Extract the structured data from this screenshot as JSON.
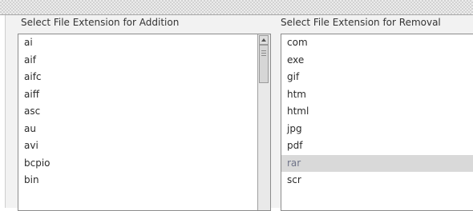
{
  "addition": {
    "label": "Select File Extension for Addition",
    "items": [
      "ai",
      "aif",
      "aifc",
      "aiff",
      "asc",
      "au",
      "avi",
      "bcpio",
      "bin"
    ]
  },
  "removal": {
    "label": "Select File Extension for Removal",
    "items": [
      "com",
      "exe",
      "gif",
      "htm",
      "html",
      "jpg",
      "pdf",
      "rar",
      "scr"
    ],
    "selected": "rar"
  },
  "icons": {
    "scroll_up": "scroll-up-arrow-icon",
    "scroll_thumb": "scroll-grip-icon"
  }
}
